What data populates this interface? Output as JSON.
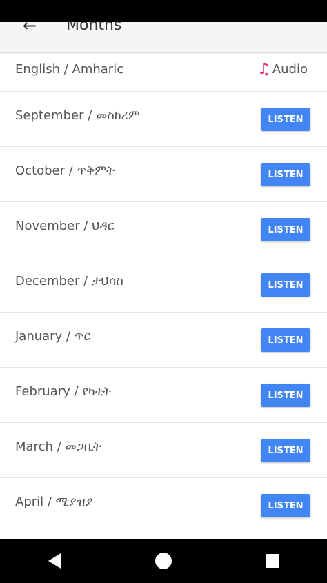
{
  "app_bar": {
    "title": "Months"
  },
  "list_header": {
    "label": "English / Amharic",
    "audio_label": "Audio",
    "audio_icon": "music-note-icon",
    "audio_color": "#e0307a"
  },
  "months": [
    {
      "label": "September / መስከረም",
      "button": "LISTEN"
    },
    {
      "label": "October / ጥቅምት",
      "button": "LISTEN"
    },
    {
      "label": "November / ህዳር",
      "button": "LISTEN"
    },
    {
      "label": "December / ታህሳስ",
      "button": "LISTEN"
    },
    {
      "label": "January / ጥር",
      "button": "LISTEN"
    },
    {
      "label": "February / የካቲት",
      "button": "LISTEN"
    },
    {
      "label": "March / መጋቢት",
      "button": "LISTEN"
    },
    {
      "label": "April / ሚያዝያ",
      "button": "LISTEN"
    }
  ],
  "colors": {
    "listen_button": "#4285f4",
    "app_bar_bg": "#f5f5f5"
  },
  "nav": {
    "back_icon": "nav-back-icon",
    "home_icon": "nav-home-icon",
    "recents_icon": "nav-recents-icon"
  }
}
